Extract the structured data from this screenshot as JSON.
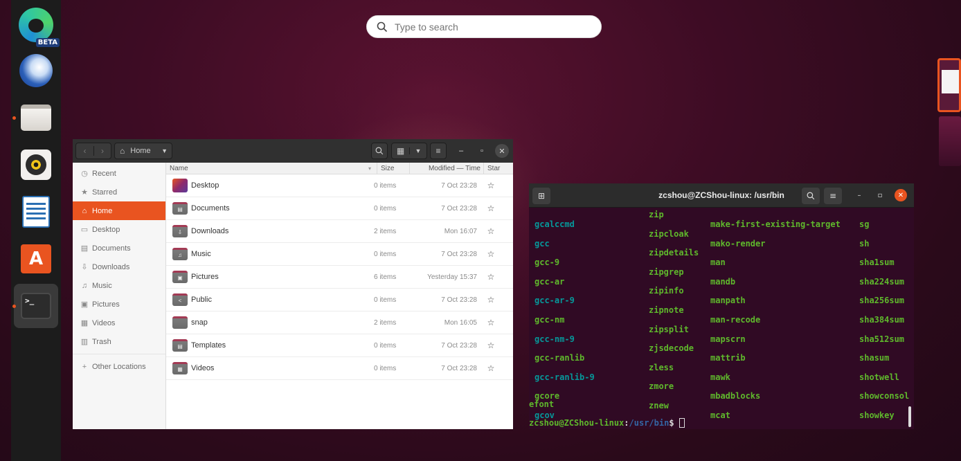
{
  "search": {
    "placeholder": "Type to search"
  },
  "dock": {
    "items": [
      {
        "name": "edge-beta",
        "icon": "edge-icon",
        "badge": "BETA"
      },
      {
        "name": "thunderbird",
        "icon": "thunderbird-icon"
      },
      {
        "name": "files",
        "icon": "files-icon"
      },
      {
        "name": "rhythmbox",
        "icon": "rhythmbox-icon"
      },
      {
        "name": "libreoffice-writer",
        "icon": "writer-icon"
      },
      {
        "name": "software",
        "icon": "software-store-icon",
        "glyph": "A"
      },
      {
        "name": "terminal",
        "icon": "terminal-icon",
        "glyph": ">_"
      }
    ],
    "accent": "#e95420"
  },
  "files": {
    "location": "Home",
    "columns": {
      "name": "Name",
      "size": "Size",
      "modified": "Modified — Time",
      "star": "Star"
    },
    "sidebar": [
      {
        "label": "Recent",
        "icon": "clock-icon",
        "glyph": "◷"
      },
      {
        "label": "Starred",
        "icon": "star-icon",
        "glyph": "★"
      },
      {
        "label": "Home",
        "icon": "home-icon",
        "glyph": "⌂"
      },
      {
        "label": "Desktop",
        "icon": "desktop-icon",
        "glyph": "▭"
      },
      {
        "label": "Documents",
        "icon": "document-icon",
        "glyph": "▤"
      },
      {
        "label": "Downloads",
        "icon": "download-icon",
        "glyph": "⇩"
      },
      {
        "label": "Music",
        "icon": "music-icon",
        "glyph": "♫"
      },
      {
        "label": "Pictures",
        "icon": "picture-icon",
        "glyph": "▣"
      },
      {
        "label": "Videos",
        "icon": "video-icon",
        "glyph": "▦"
      },
      {
        "label": "Trash",
        "icon": "trash-icon",
        "glyph": "▥"
      },
      {
        "label": "Other Locations",
        "icon": "plus-icon",
        "glyph": "+"
      }
    ],
    "rows": [
      {
        "name": "Desktop",
        "size": "0 items",
        "modified": "7 Oct 23:28",
        "glyph": ""
      },
      {
        "name": "Documents",
        "size": "0 items",
        "modified": "7 Oct 23:28",
        "glyph": "▤"
      },
      {
        "name": "Downloads",
        "size": "2 items",
        "modified": "Mon 16:07",
        "glyph": "⇩"
      },
      {
        "name": "Music",
        "size": "0 items",
        "modified": "7 Oct 23:28",
        "glyph": "♫"
      },
      {
        "name": "Pictures",
        "size": "6 items",
        "modified": "Yesterday 15:37",
        "glyph": "▣"
      },
      {
        "name": "Public",
        "size": "0 items",
        "modified": "7 Oct 23:28",
        "glyph": "<"
      },
      {
        "name": "snap",
        "size": "2 items",
        "modified": "Mon 16:05",
        "glyph": ""
      },
      {
        "name": "Templates",
        "size": "0 items",
        "modified": "7 Oct 23:28",
        "glyph": "▤"
      },
      {
        "name": "Videos",
        "size": "0 items",
        "modified": "7 Oct 23:28",
        "glyph": "▦"
      }
    ],
    "star_glyph": "☆"
  },
  "terminal": {
    "title": "zcshou@ZCShou-linux: /usr/bin",
    "col1": [
      "gcalccmd",
      "gcc",
      "gcc-9",
      "gcc-ar",
      "gcc-ar-9",
      "gcc-nm",
      "gcc-nm-9",
      "gcc-ranlib",
      "gcc-ranlib-9",
      "gcore",
      "gcov"
    ],
    "col1_extra": "efont",
    "col2": [
      "zip",
      "zipcloak",
      "zipdetails",
      "zipgrep",
      "zipinfo",
      "zipnote",
      "zipsplit",
      "zjsdecode",
      "zless",
      "zmore",
      "znew"
    ],
    "col3": [
      "make-first-existing-target",
      "mako-render",
      "man",
      "mandb",
      "manpath",
      "man-recode",
      "mapscrn",
      "mattrib",
      "mawk",
      "mbadblocks",
      "mcat"
    ],
    "col4": [
      "sg",
      "sh",
      "sha1sum",
      "sha224sum",
      "sha256sum",
      "sha384sum",
      "sha512sum",
      "shasum",
      "shotwell",
      "showconsol",
      "showkey"
    ],
    "prompt_user": "zcshou@ZCShou-linux",
    "prompt_path": "/usr/bin",
    "prompt_sep": ":",
    "prompt_end": "$ "
  }
}
